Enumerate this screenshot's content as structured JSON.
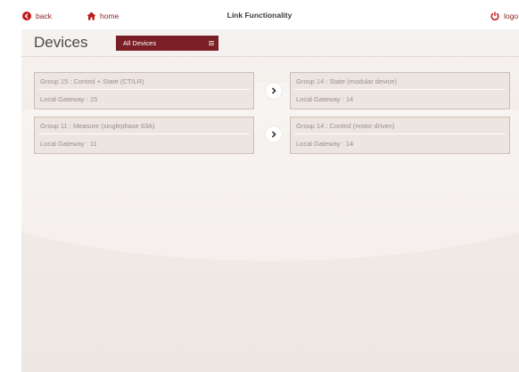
{
  "topbar": {
    "back_label": "back",
    "home_label": "home",
    "title": "Link Functionality",
    "logout_label": "logo"
  },
  "devices": {
    "title": "Devices",
    "filter_selected": "All Devices"
  },
  "links": [
    {
      "source": {
        "group": "Group 15 : Control + State (CT/LR)",
        "gateway": "Local Gateway : 15"
      },
      "target": {
        "group": "Group 14 : State (modular device)",
        "gateway": "Local Gateway : 14"
      }
    },
    {
      "source": {
        "group": "Group 11 : Measure (singlephase 63A)",
        "gateway": "Local Gateway : 11"
      },
      "target": {
        "group": "Group 14 : Control (motor driven)",
        "gateway": "Local Gateway : 14"
      }
    }
  ],
  "colors": {
    "accent": "#8a2020",
    "select_bg": "#7b1f26",
    "panel_bg": "#f3ede9"
  },
  "icons": {
    "back": "back-circle-icon",
    "home": "home-icon",
    "logout": "power-icon",
    "link": "chevron-right-icon",
    "menu": "menu-icon"
  }
}
